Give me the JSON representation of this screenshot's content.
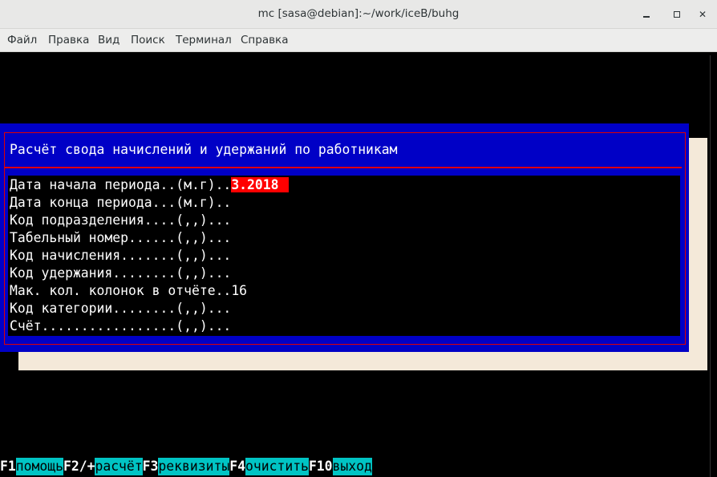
{
  "window": {
    "title": "mc [sasa@debian]:~/work/iceB/buhg"
  },
  "menu": [
    "Файл",
    "Правка",
    "Вид",
    "Поиск",
    "Терминал",
    "Справка"
  ],
  "dialog": {
    "title": "Расчёт свода начислений и удержаний по работникам",
    "fields": [
      {
        "label": "Дата начала периода..(м.г)..",
        "value": "3.2018"
      },
      {
        "label": "Дата конца периода...(м.г)..",
        "value": ""
      },
      {
        "label": "Код подразделения....(,,)...",
        "value": ""
      },
      {
        "label": "Табельный номер......(,,)...",
        "value": ""
      },
      {
        "label": "Код начисления.......(,,)...",
        "value": ""
      },
      {
        "label": "Код удержания........(,,)...",
        "value": ""
      },
      {
        "label": "Мак. кол. колонок в отчёте..",
        "value": "16"
      },
      {
        "label": "Код категории........(,,)...",
        "value": ""
      },
      {
        "label": "Счёт.................(,,)...",
        "value": ""
      }
    ]
  },
  "fkeys": [
    {
      "key": "F1",
      "label": "помощь"
    },
    {
      "key": "F2/+",
      "label": "расчёт"
    },
    {
      "key": "F3",
      "label": "реквизиты"
    },
    {
      "key": "F4",
      "label": "очистить"
    },
    {
      "key": "F10",
      "label": "выход"
    }
  ],
  "colors": {
    "dialog_bg": "#0000c6",
    "frame": "#e00000",
    "active_field": "#ff0000",
    "fkey_label_bg": "#00c4c4",
    "shadow": "#f4e9d9"
  }
}
